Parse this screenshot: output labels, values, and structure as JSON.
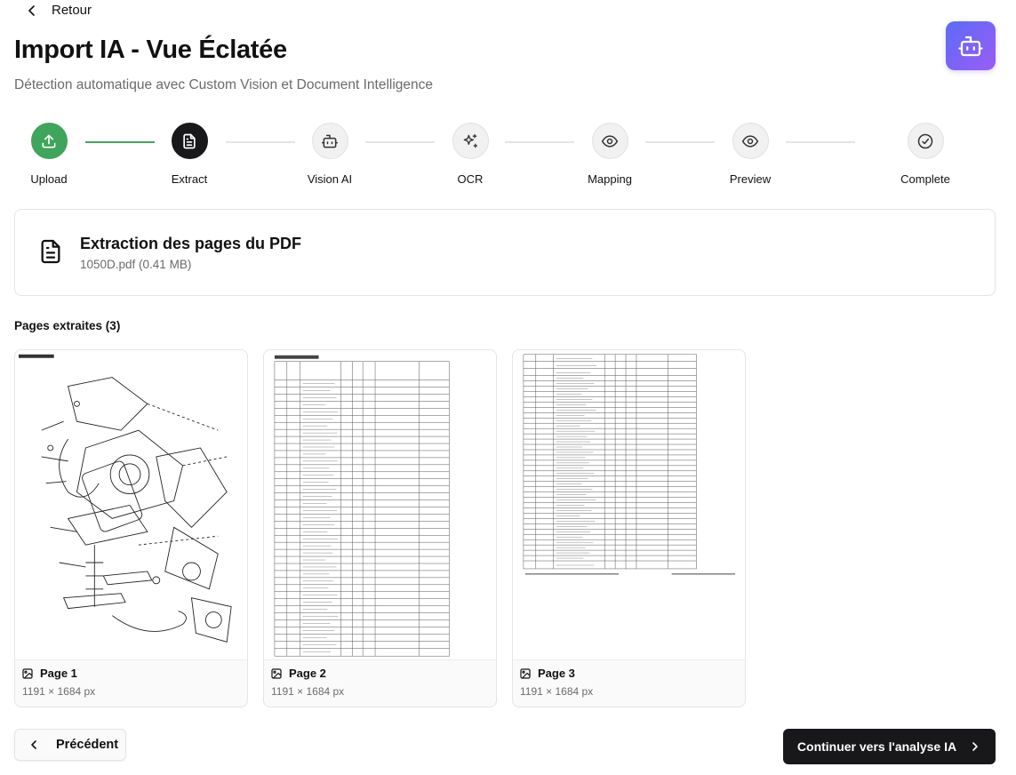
{
  "header": {
    "back_label": "Retour",
    "title": "Import IA - Vue Éclatée",
    "subtitle": "Détection automatique avec Custom Vision et Document Intelligence",
    "assistant_icon": "bot-icon",
    "accent_gradient": [
      "#5b6cf5",
      "#9b5cf6"
    ]
  },
  "stepper": {
    "steps": [
      {
        "label": "Upload",
        "icon": "upload-icon",
        "state": "done"
      },
      {
        "label": "Extract",
        "icon": "file-text-icon",
        "state": "active"
      },
      {
        "label": "Vision AI",
        "icon": "bot-icon",
        "state": "pending"
      },
      {
        "label": "OCR",
        "icon": "sparkles-icon",
        "state": "pending"
      },
      {
        "label": "Mapping",
        "icon": "eye-icon",
        "state": "pending"
      },
      {
        "label": "Preview",
        "icon": "eye-icon",
        "state": "pending"
      },
      {
        "label": "Complete",
        "icon": "check-circle-icon",
        "state": "pending"
      }
    ],
    "colors": {
      "done": "#3fa55a",
      "active": "#18181b",
      "pending": "#f1f1f2"
    }
  },
  "extraction": {
    "title": "Extraction des pages du PDF",
    "file": "1050D.pdf (0.41 MB)"
  },
  "pages_section": {
    "title": "Pages extraites (3)",
    "pages": [
      {
        "name": "Page 1",
        "dims": "1191 × 1684 px"
      },
      {
        "name": "Page 2",
        "dims": "1191 × 1684 px"
      },
      {
        "name": "Page 3",
        "dims": "1191 × 1684 px"
      }
    ]
  },
  "footer": {
    "prev_label": "Précédent",
    "next_label": "Continuer vers l'analyse IA"
  }
}
